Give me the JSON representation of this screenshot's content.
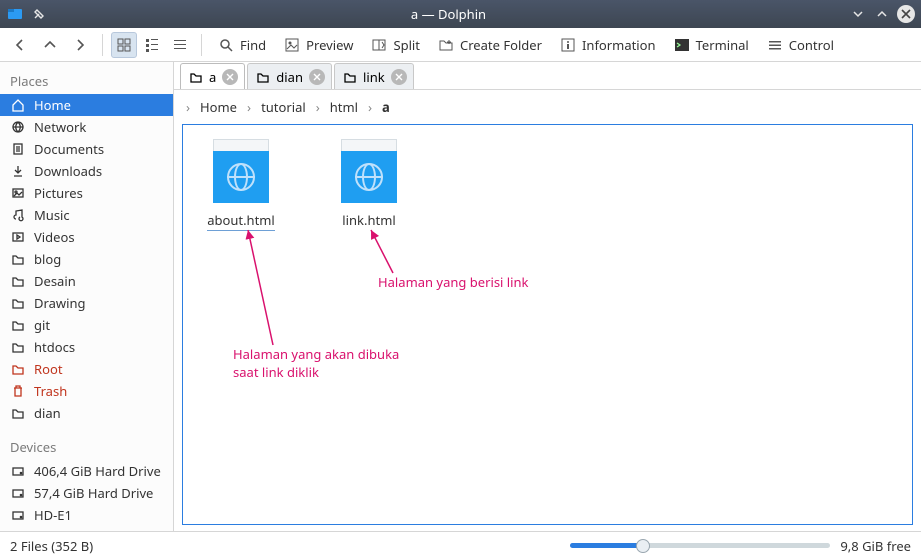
{
  "title": "a — Dolphin",
  "toolbar": {
    "find": "Find",
    "preview": "Preview",
    "split": "Split",
    "create_folder": "Create Folder",
    "information": "Information",
    "terminal": "Terminal",
    "control": "Control"
  },
  "sidebar": {
    "places_heading": "Places",
    "devices_heading": "Devices",
    "places": [
      {
        "label": "Home",
        "icon": "home",
        "selected": true
      },
      {
        "label": "Network",
        "icon": "network"
      },
      {
        "label": "Documents",
        "icon": "documents"
      },
      {
        "label": "Downloads",
        "icon": "downloads"
      },
      {
        "label": "Pictures",
        "icon": "pictures"
      },
      {
        "label": "Music",
        "icon": "music"
      },
      {
        "label": "Videos",
        "icon": "videos"
      },
      {
        "label": "blog",
        "icon": "folder"
      },
      {
        "label": "Desain",
        "icon": "folder"
      },
      {
        "label": "Drawing",
        "icon": "folder"
      },
      {
        "label": "git",
        "icon": "folder"
      },
      {
        "label": "htdocs",
        "icon": "folder"
      },
      {
        "label": "Root",
        "icon": "folder",
        "red": true
      },
      {
        "label": "Trash",
        "icon": "trash",
        "red": true
      },
      {
        "label": "dian",
        "icon": "folder"
      }
    ],
    "devices": [
      {
        "label": "406,4 GiB Hard Drive",
        "icon": "drive"
      },
      {
        "label": "57,4 GiB Hard Drive",
        "icon": "drive"
      },
      {
        "label": "HD-E1",
        "icon": "drive"
      }
    ]
  },
  "tabs": [
    {
      "label": "a",
      "active": true
    },
    {
      "label": "dian",
      "active": false
    },
    {
      "label": "link",
      "active": false
    }
  ],
  "breadcrumbs": [
    "Home",
    "tutorial",
    "html",
    "a"
  ],
  "files": [
    {
      "name": "about.html",
      "underlined": true
    },
    {
      "name": "link.html",
      "underlined": false
    }
  ],
  "annotations": {
    "anno1_line1": "Halaman yang akan dibuka",
    "anno1_line2": "saat link diklik",
    "anno2": "Halaman yang berisi link"
  },
  "status": {
    "text": "2 Files (352 B)",
    "free": "9,8 GiB free"
  }
}
